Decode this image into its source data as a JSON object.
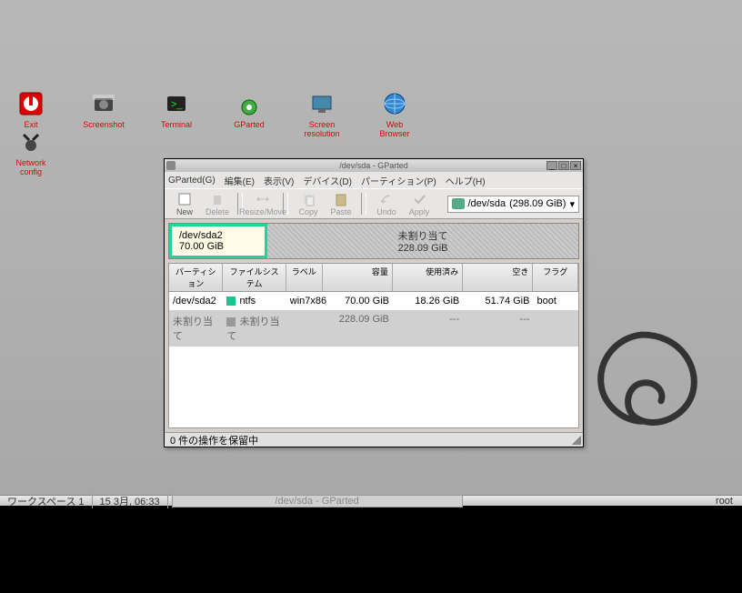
{
  "desktop_icons": [
    {
      "label": "Exit",
      "name": "exit-icon"
    },
    {
      "label": "Screenshot",
      "name": "screenshot-icon"
    },
    {
      "label": "Terminal",
      "name": "terminal-icon"
    },
    {
      "label": "GParted",
      "name": "gparted-icon"
    },
    {
      "label": "Screen resolution",
      "name": "screen-resolution-icon"
    },
    {
      "label": "Web Browser",
      "name": "web-browser-icon"
    }
  ],
  "desktop_icons_row2": [
    {
      "label": "Network config",
      "name": "network-config-icon"
    }
  ],
  "window": {
    "title": "/dev/sda - GParted",
    "menus": [
      "GParted(G)",
      "編集(E)",
      "表示(V)",
      "デバイス(D)",
      "パーティション(P)",
      "ヘルプ(H)"
    ],
    "toolbar": [
      {
        "label": "New",
        "name": "new-button"
      },
      {
        "label": "Delete",
        "name": "delete-button"
      },
      {
        "label": "Resize/Move",
        "name": "resize-button"
      },
      {
        "label": "Copy",
        "name": "copy-button"
      },
      {
        "label": "Paste",
        "name": "paste-button"
      },
      {
        "label": "Undo",
        "name": "undo-button"
      },
      {
        "label": "Apply",
        "name": "apply-button"
      }
    ],
    "device_selector": {
      "label": "/dev/sda",
      "size": "(298.09 GiB)"
    },
    "partition_visual": {
      "selected": {
        "name": "/dev/sda2",
        "size": "70.00 GiB"
      },
      "unallocated": {
        "label": "未割り当て",
        "size": "228.09 GiB"
      }
    },
    "columns": [
      "パーティション",
      "ファイルシステム",
      "ラベル",
      "容量",
      "使用済み",
      "空き",
      "フラグ"
    ],
    "rows": [
      {
        "part": "/dev/sda2",
        "fs": "ntfs",
        "label": "win7x86",
        "size": "70.00 GiB",
        "used": "18.26 GiB",
        "free": "51.74 GiB",
        "flags": "boot"
      },
      {
        "part": "未割り当て",
        "fs": "未割り当て",
        "label": "",
        "size": "228.09 GiB",
        "used": "---",
        "free": "---",
        "flags": ""
      }
    ],
    "status": "0 件の操作を保留中"
  },
  "taskbar": {
    "workspace": "ワークスペース 1",
    "datetime": "15 3月, 06:33",
    "task": "/dev/sda - GParted",
    "right": "root"
  }
}
